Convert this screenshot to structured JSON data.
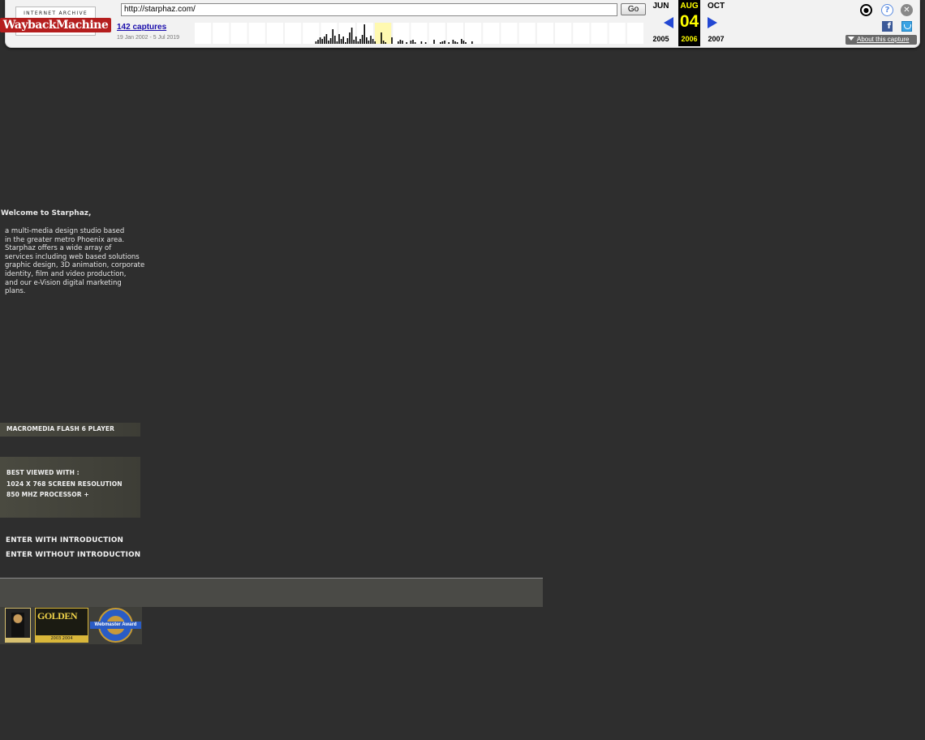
{
  "wayback": {
    "logo_top": "INTERNET ARCHIVE",
    "logo_bottom": "WaybackMachine",
    "url": "http://starphaz.com/",
    "go_label": "Go",
    "captures": "142 captures",
    "date_range": "19 Jan 2002 - 5 Jul 2019",
    "months": {
      "prev": "JUN",
      "current": "AUG",
      "next": "OCT"
    },
    "day": "04",
    "years": {
      "prev": "2005",
      "current": "2006",
      "next": "2007"
    },
    "about_label": "About this capture",
    "icons": [
      "user-icon",
      "help-icon",
      "close-icon",
      "facebook-icon",
      "twitter-icon"
    ]
  },
  "page": {
    "welcome": "Welcome to Starphaz,",
    "intro_lines": [
      "a multi-media design studio based",
      "in the greater metro Phoenix area.",
      "Starphaz offers a wide array of",
      "services including web based solutions",
      "graphic design, 3D animation, corporate",
      "identity, film and video production,",
      "and our e-Vision digital marketing",
      "plans."
    ],
    "flash_label": "MACROMEDIA FLASH 6 PLAYER",
    "best_viewed": [
      "BEST VIEWED WITH :",
      "1024 X 768 SCREEN RESOLUTION",
      "850 MHZ PROCESSOR +"
    ],
    "enter_intro": "ENTER WITH INTRODUCTION",
    "enter_no_intro": "ENTER WITHOUT INTRODUCTION",
    "awards": {
      "golden_title": "GOLDEN",
      "golden_years": "2003   2004",
      "webmaster": "Webmaster Award"
    }
  },
  "colors": {
    "background": "#2e2e2e",
    "toolbar": "#f2f2f2",
    "highlight": "#ffff00",
    "link": "#1a0dab"
  }
}
